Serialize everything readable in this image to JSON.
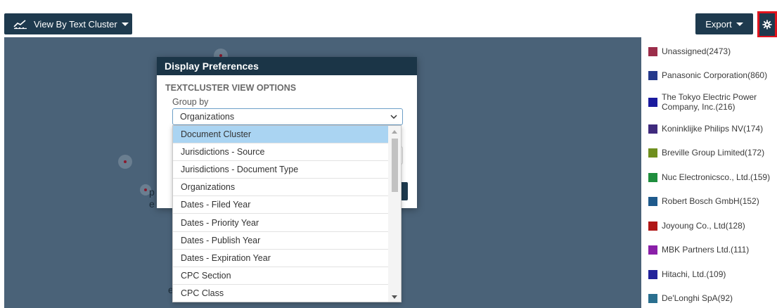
{
  "toolbar": {
    "view_label": "View By Text Cluster",
    "export_label": "Export"
  },
  "icons": {
    "view": "line-chart-icon",
    "settings": "gear-icon",
    "caret": "caret-down-icon"
  },
  "canvas": {
    "fragments": [
      "p",
      "e",
      "e"
    ]
  },
  "legend": {
    "items": [
      {
        "label": "Unassigned(2473)",
        "color": "#9b2d4a"
      },
      {
        "label": "Panasonic Corporation(860)",
        "color": "#263a8c"
      },
      {
        "label": "The Tokyo Electric Power Company, Inc.(216)",
        "color": "#1a1a9e"
      },
      {
        "label": "Koninklijke Philips NV(174)",
        "color": "#3f2a7d"
      },
      {
        "label": "Breville Group Limited(172)",
        "color": "#6f8f1e"
      },
      {
        "label": "Nuc Electronicsco., Ltd.(159)",
        "color": "#1f8e3d"
      },
      {
        "label": "Robert Bosch GmbH(152)",
        "color": "#1f5a8c"
      },
      {
        "label": "Joyoung Co., Ltd(128)",
        "color": "#b01616"
      },
      {
        "label": "MBK Partners Ltd.(111)",
        "color": "#8a1fa8"
      },
      {
        "label": "Hitachi, Ltd.(109)",
        "color": "#22229a"
      },
      {
        "label": "De'Longhi SpA(92)",
        "color": "#2a6f8f"
      }
    ]
  },
  "dialog": {
    "title": "Display Preferences",
    "section_title": "TEXTCLUSTER VIEW OPTIONS",
    "group_by_label": "Group by",
    "group_by_value": "Organizations",
    "options": [
      "Document Cluster",
      "Jurisdictions - Source",
      "Jurisdictions - Document Type",
      "Organizations",
      "Dates - Filed Year",
      "Dates - Priority Year",
      "Dates - Publish Year",
      "Dates - Expiration Year",
      "CPC Section",
      "CPC Class"
    ],
    "highlighted_option": "Document Cluster"
  },
  "colors": {
    "toolbar_button": "#1e3a4e",
    "canvas": "#4a6278",
    "dialog_header": "#1b3547",
    "highlight": "#aad4f2",
    "settings_outline": "#e0141e"
  }
}
